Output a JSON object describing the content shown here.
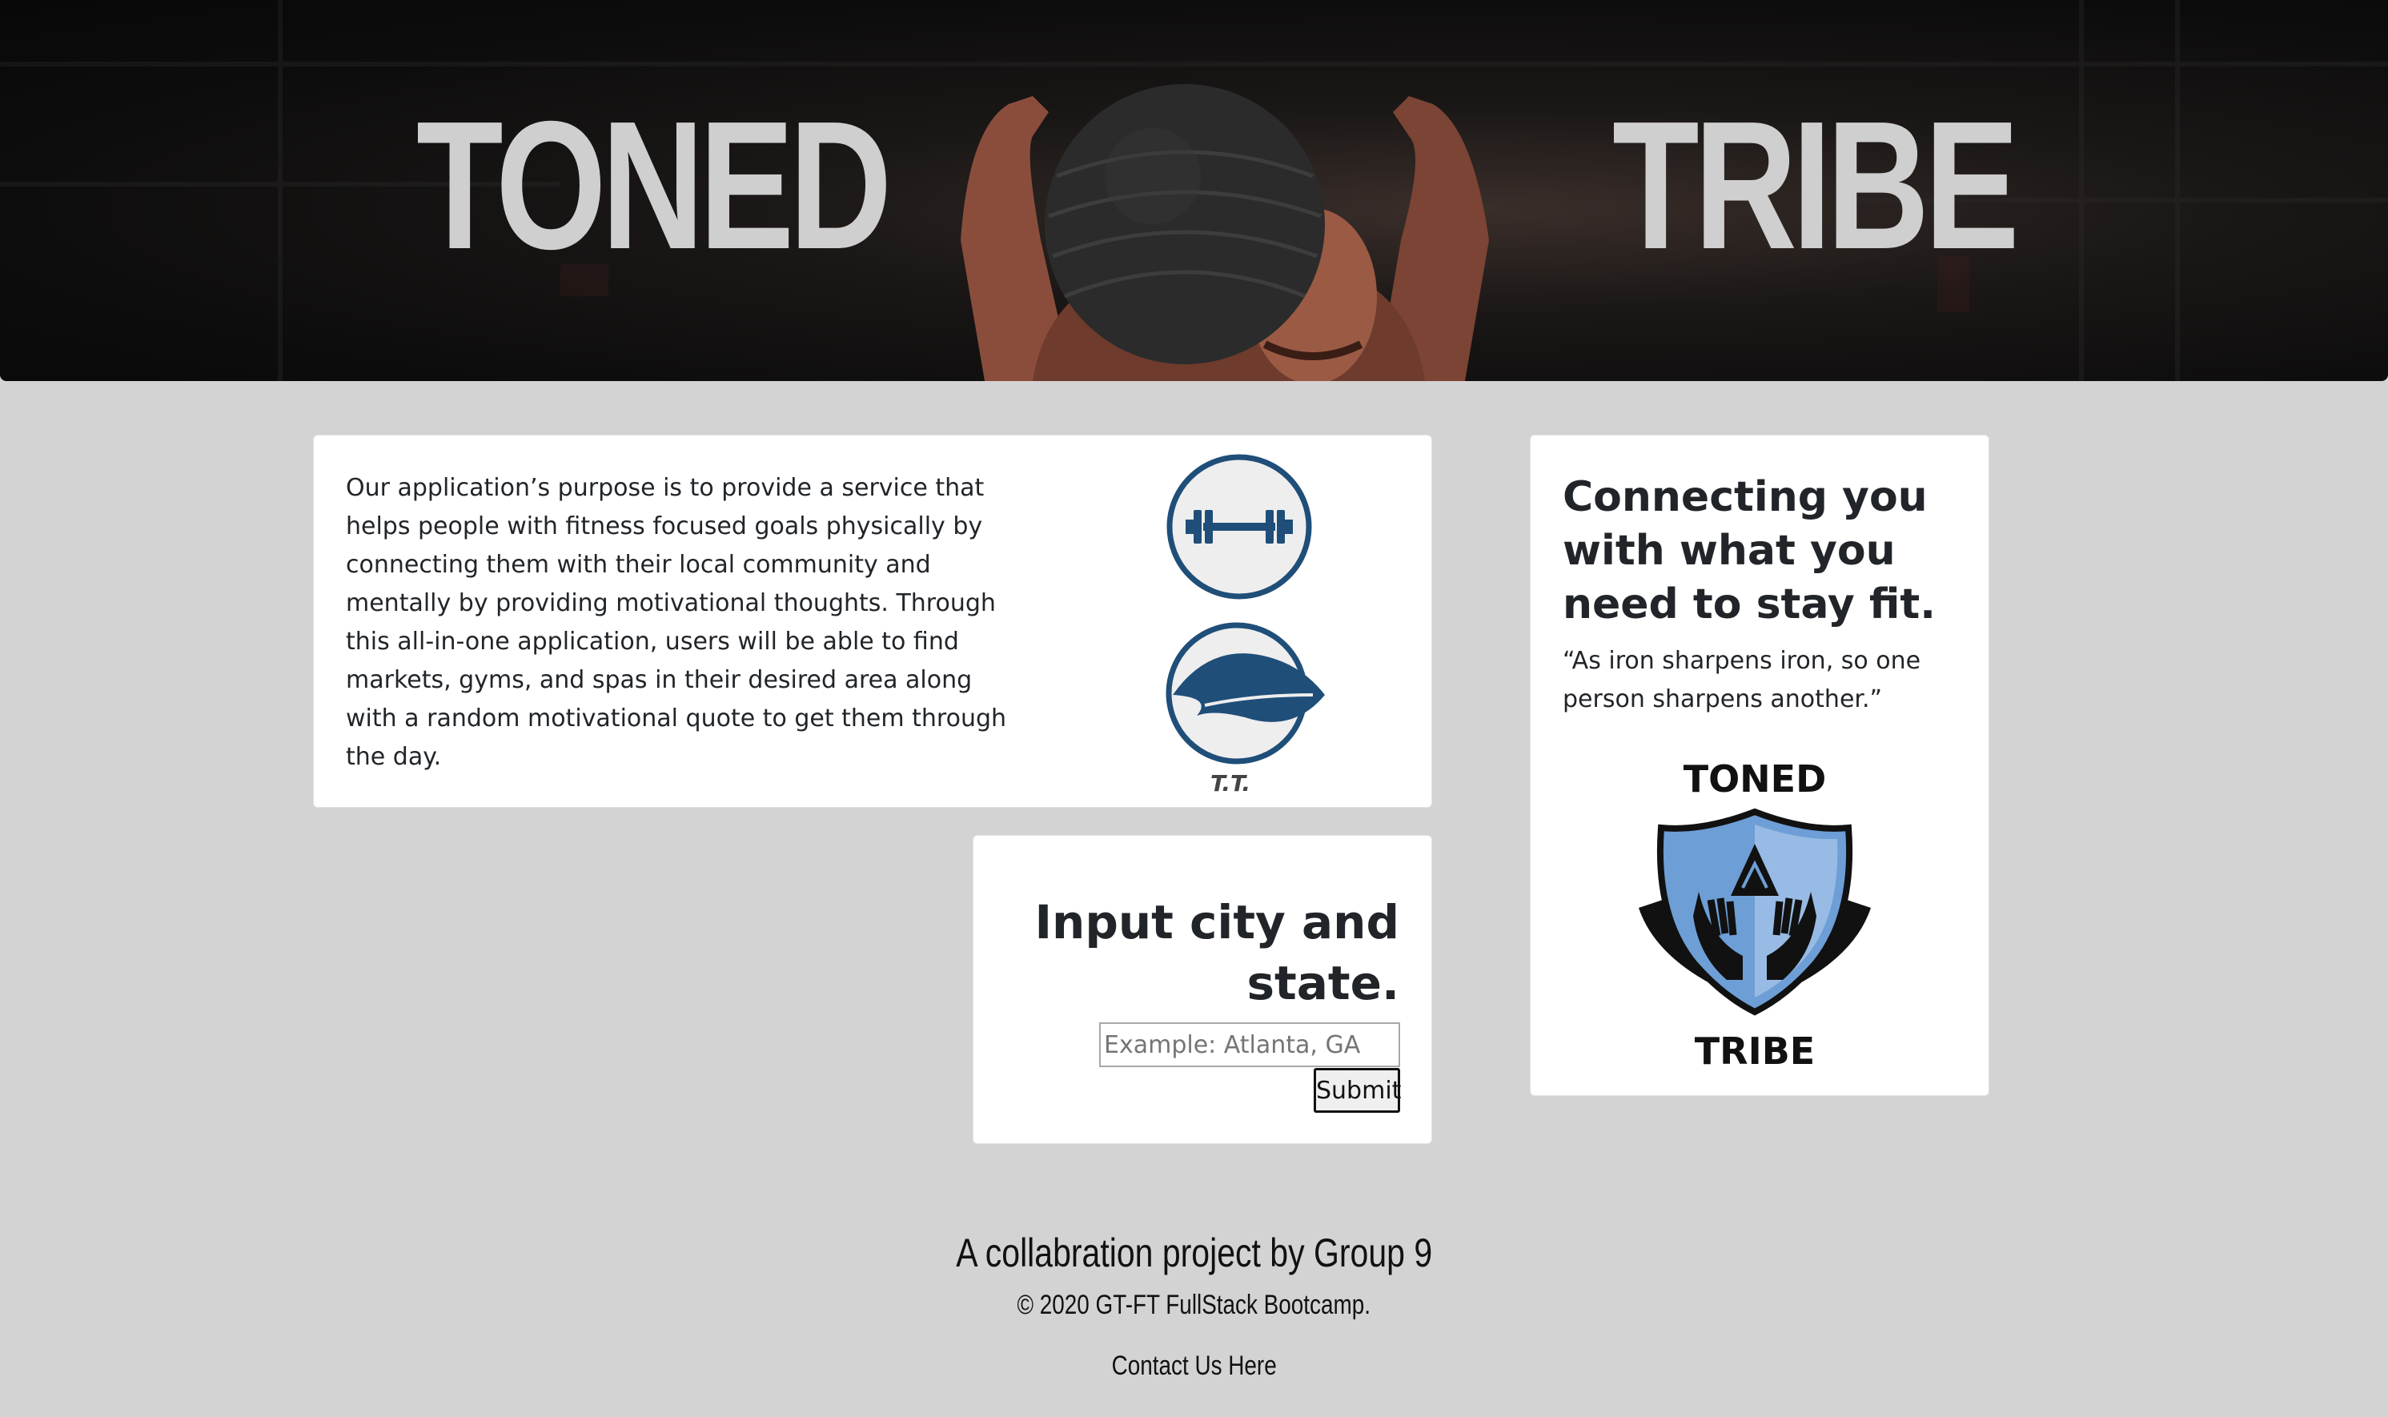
{
  "hero": {
    "title_left": "TONED",
    "title_right": "TRIBE"
  },
  "about": {
    "text": "Our application’s purpose is to provide a service that helps people with fitness focused goals physically by connecting them with their local community and mentally by providing motivational thoughts. Through this all-in-one application, users will be able to find markets, gyms, and spas in their desired area along with a random motivational quote to get them through the day.",
    "icon_caption": "T.T."
  },
  "search": {
    "title": "Input city and state.",
    "placeholder": "Example: Atlanta, GA",
    "value": "",
    "submit_label": "Submit"
  },
  "connect": {
    "title": "Connecting you with what you need to stay fit.",
    "quote": "“As iron sharpens iron, so one person sharpens another.”",
    "logo_top": "TONED",
    "logo_bottom": "TRIBE"
  },
  "footer": {
    "title": "A collabration project by Group 9",
    "copyright": "© 2020 GT-FT FullStack Bootcamp.",
    "contact": "Contact Us Here"
  },
  "colors": {
    "background": "#d3d3d3",
    "card": "#ffffff",
    "icon_blue": "#1f4e79",
    "hero_text": "#cfcfcf"
  }
}
